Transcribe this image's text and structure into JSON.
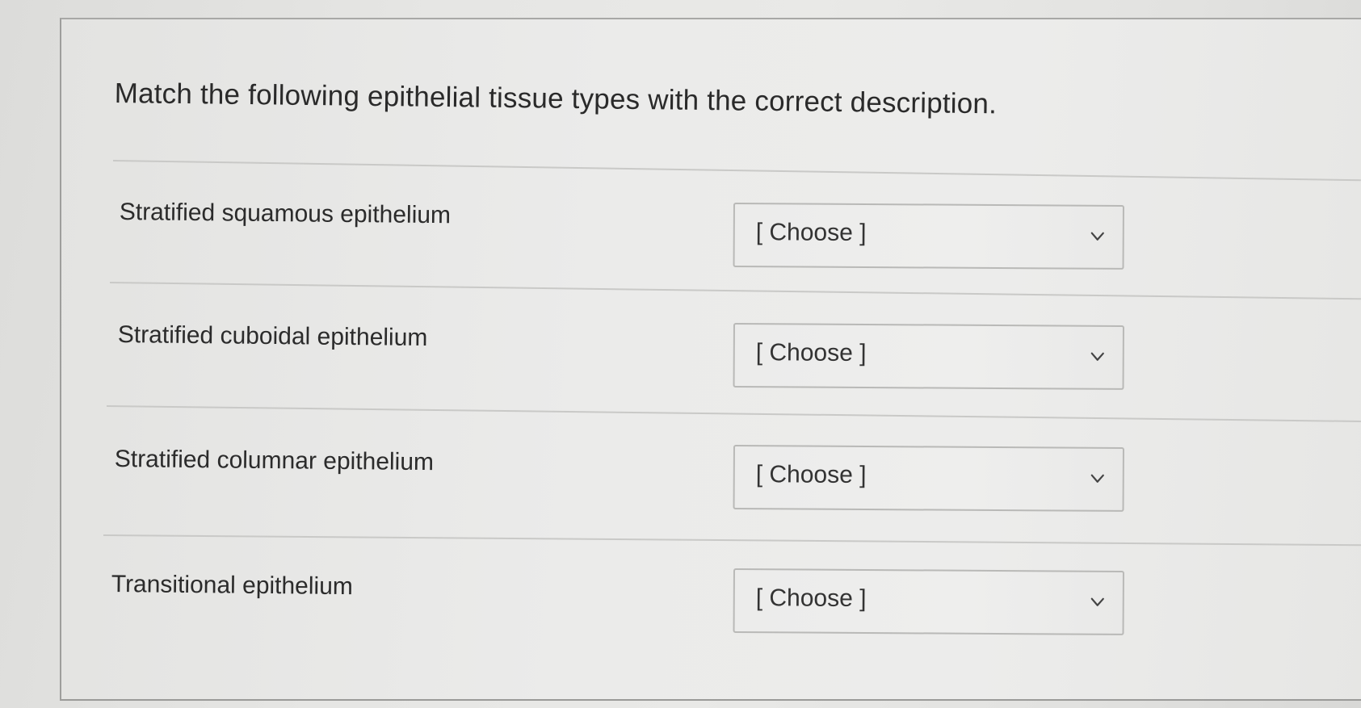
{
  "question": {
    "prompt": "Match the following epithelial tissue types with the correct description."
  },
  "matches": [
    {
      "term": "Stratified squamous epithelium",
      "selected": "[ Choose ]"
    },
    {
      "term": "Stratified cuboidal epithelium",
      "selected": "[ Choose ]"
    },
    {
      "term": "Stratified columnar epithelium",
      "selected": "[ Choose ]"
    },
    {
      "term": "Transitional epithelium",
      "selected": "[ Choose ]"
    }
  ],
  "icons": {
    "dropdown": "chevron-down-icon"
  },
  "colors": {
    "text": "#2b2b2b",
    "panel_background": "#ebebea",
    "select_border": "#b9b9b7",
    "divider": "#c9c9c7"
  }
}
